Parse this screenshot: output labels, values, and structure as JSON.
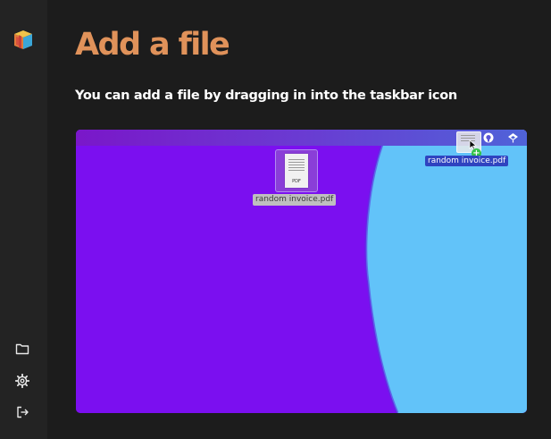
{
  "page": {
    "title": "Add a file",
    "subtitle": "You can add a file by dragging in into the taskbar icon"
  },
  "sidebar": {
    "logo_icon": "app-logo-icon",
    "items": [
      {
        "icon": "folder-icon"
      },
      {
        "icon": "gear-icon"
      },
      {
        "icon": "logout-icon"
      }
    ]
  },
  "demo": {
    "desktop_file": {
      "name": "random invoice.pdf",
      "type_tag": "PDF"
    },
    "drag_file": {
      "name": "random invoice.pdf",
      "badge": "+"
    },
    "taskbar_icons": [
      "github-icon",
      "app-tray-icon"
    ]
  },
  "colors": {
    "background": "#1c1c1c",
    "sidebar": "#232323",
    "title_accent": "#e0925a",
    "wallpaper_purple": "#7b0ff0",
    "wallpaper_blue": "#62c3f9",
    "drag_label_bg": "#2f43c0",
    "add_badge": "#34c24a"
  }
}
